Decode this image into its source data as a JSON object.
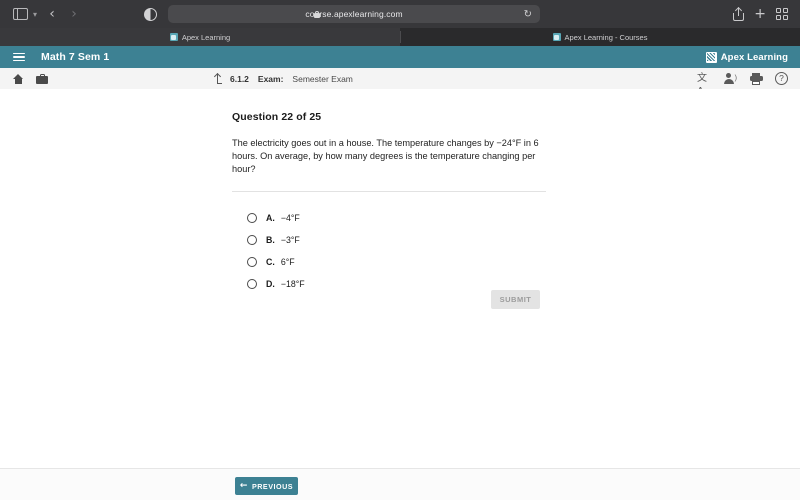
{
  "browser": {
    "url": "course.apexlearning.com",
    "lock_icon": "lock-icon",
    "reload_icon": "↻",
    "back_icon": "‹",
    "forward_icon": "›",
    "sidebar_icon": "sidebar-toggle-icon",
    "sidebar_chevron": "▾",
    "reader_icon": "reader-mode-icon",
    "share_icon": "share-icon",
    "new_tab_icon": "+",
    "tab_overview_icon": "tab-overview-icon",
    "tabs": [
      {
        "title": "Apex Learning",
        "active": true
      },
      {
        "title": "Apex Learning - Courses",
        "active": false
      }
    ]
  },
  "app_header": {
    "menu_icon": "hamburger-menu-icon",
    "course_title": "Math 7 Sem 1",
    "brand_name": "Apex Learning",
    "brand_color": "#3d8193"
  },
  "breadcrumb": {
    "home_icon": "home-icon",
    "briefcase_icon": "briefcase-icon",
    "up_icon": "up-arrow-icon",
    "lesson_number": "6.1.2",
    "type_label": "Exam:",
    "activity_name": "Semester Exam",
    "tools": [
      {
        "name": "translate-icon",
        "glyph": "文A"
      },
      {
        "name": "read-aloud-icon",
        "glyph": ")"
      },
      {
        "name": "print-icon",
        "glyph": ""
      },
      {
        "name": "help-icon",
        "glyph": "?"
      }
    ]
  },
  "question": {
    "heading": "Question 22 of 25",
    "number": 22,
    "total": 25,
    "text": "The electricity goes out in a house. The temperature changes by −24°F in 6 hours. On average, by how many degrees is the temperature changing per hour?",
    "options": [
      {
        "letter": "A.",
        "value": "−4°F",
        "selected": false
      },
      {
        "letter": "B.",
        "value": "−3°F",
        "selected": false
      },
      {
        "letter": "C.",
        "value": "6°F",
        "selected": false
      },
      {
        "letter": "D.",
        "value": "−18°F",
        "selected": false
      }
    ],
    "submit_label": "SUBMIT",
    "submit_enabled": false
  },
  "footer": {
    "previous_label": "PREVIOUS",
    "previous_arrow": "←"
  }
}
